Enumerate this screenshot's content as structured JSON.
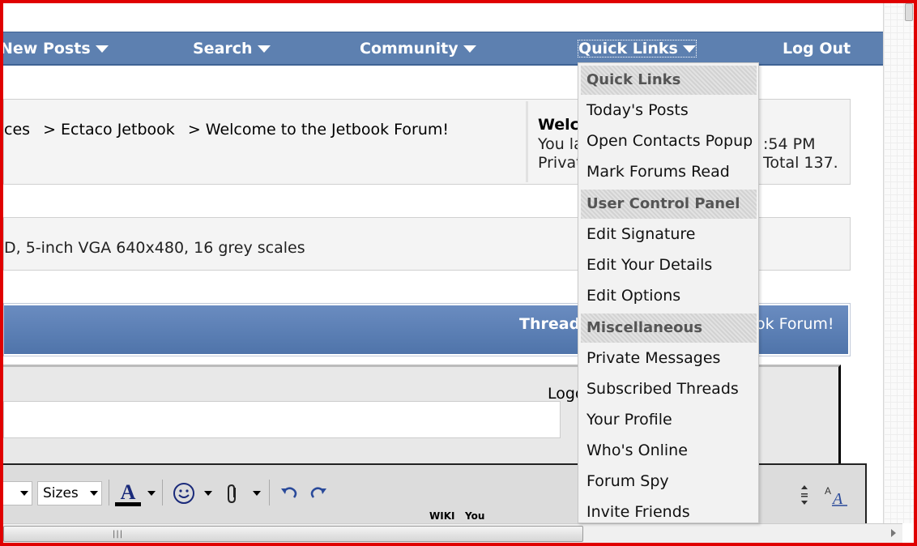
{
  "navbar": {
    "items": [
      {
        "label": "New Posts"
      },
      {
        "label": "Search"
      },
      {
        "label": "Community"
      },
      {
        "label": "Quick Links"
      },
      {
        "label": "Log Out"
      }
    ]
  },
  "breadcrumb": {
    "items": [
      "ces",
      "> Ectaco Jetbook",
      "> Welcome to the Jetbook Forum!"
    ]
  },
  "welcome_panel": {
    "title": "Welco",
    "line1_left": "You la",
    "line1_right": ":54 PM",
    "line2_left": "Privat",
    "line2_right": "Total 137."
  },
  "forum_description": "D, 5-inch VGA 640x480, 16 grey scales",
  "thread_bar": {
    "left_text": "Thread",
    "right_text": "ok Forum!"
  },
  "post_editor": {
    "logo_text": "Logo",
    "sizes_label": "Sizes",
    "row2_labels": [
      "WIKI",
      "You"
    ]
  },
  "quick_links_menu": {
    "sections": [
      {
        "header": "Quick Links",
        "items": [
          "Today's Posts",
          "Open Contacts Popup",
          "Mark Forums Read"
        ]
      },
      {
        "header": "User Control Panel",
        "items": [
          "Edit Signature",
          "Edit Your Details",
          "Edit Options"
        ]
      },
      {
        "header": "Miscellaneous",
        "items": [
          "Private Messages",
          "Subscribed Threads",
          "Your Profile",
          "Who's Online",
          "Forum Spy",
          "Invite Friends"
        ]
      }
    ]
  },
  "colors": {
    "navbar": "#5d80b0",
    "frame": "#e00000",
    "menu_bg": "#f2f2f2"
  }
}
